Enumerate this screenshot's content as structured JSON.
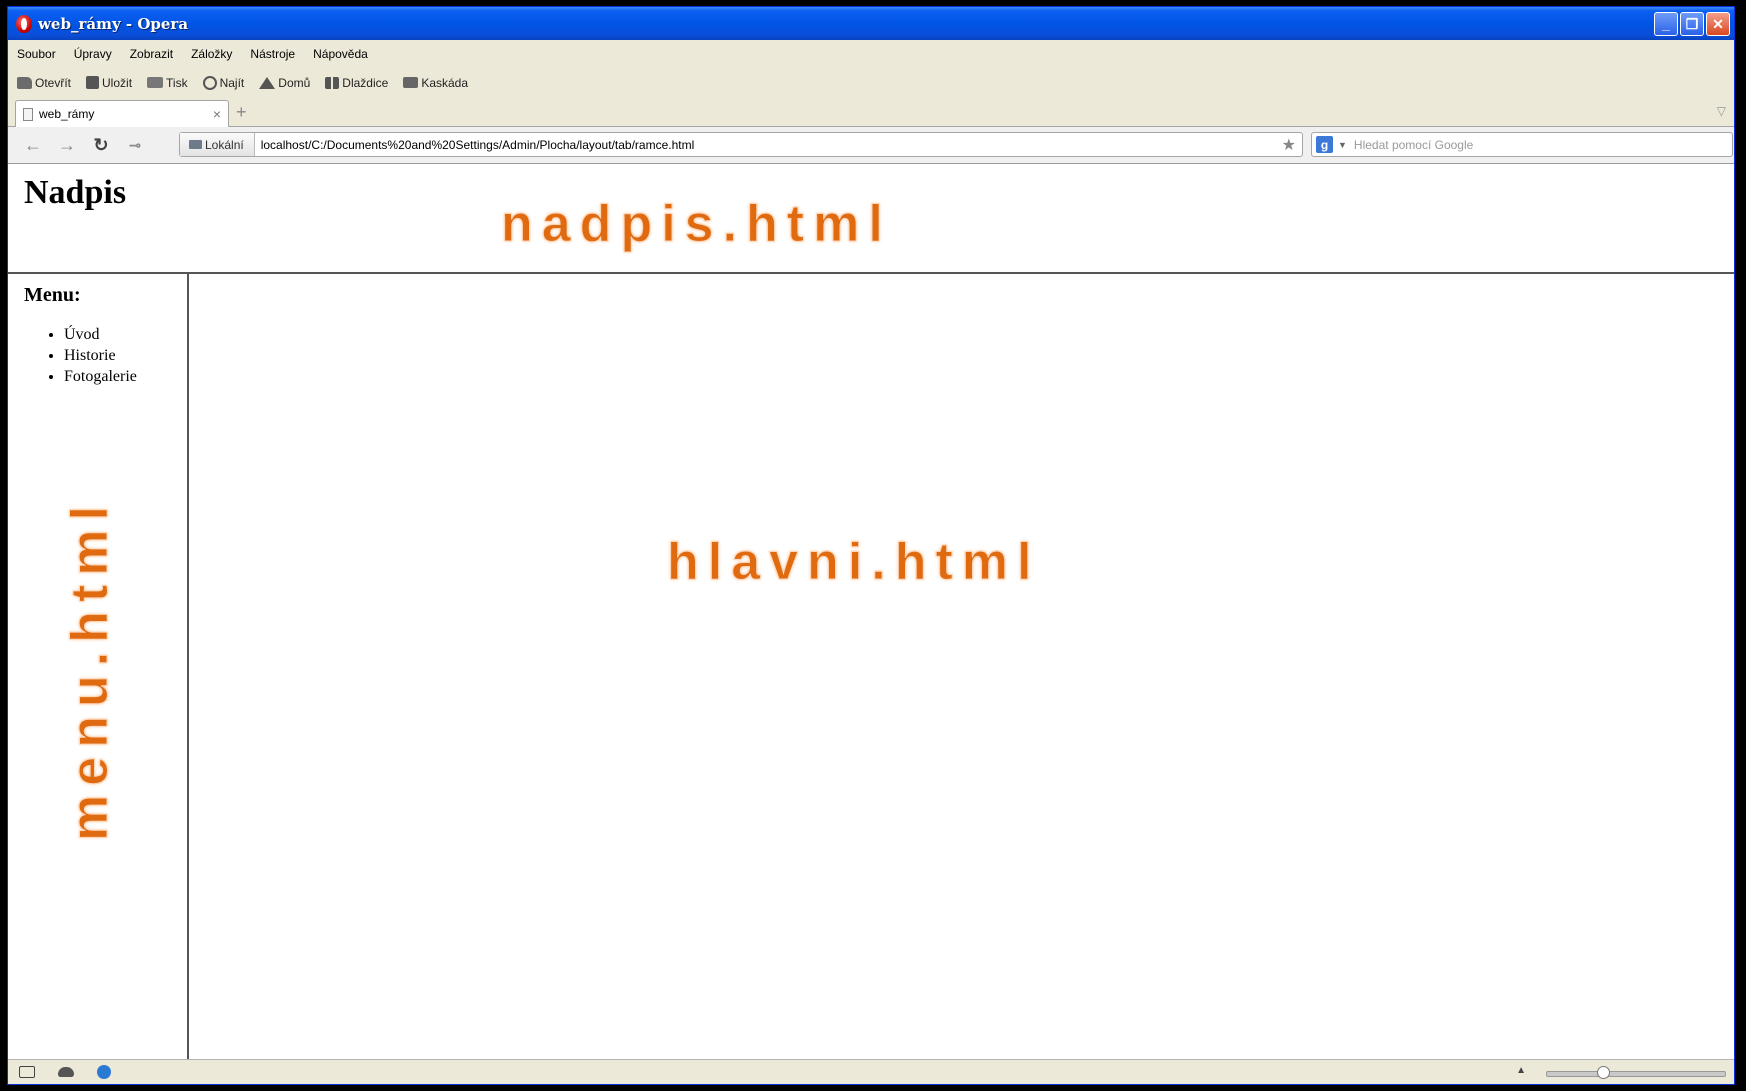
{
  "window": {
    "title": "web_rámy - Opera",
    "controls": {
      "minimize": "_",
      "restore": "❐",
      "close": "✕"
    }
  },
  "menubar": {
    "items": [
      "Soubor",
      "Úpravy",
      "Zobrazit",
      "Záložky",
      "Nástroje",
      "Nápověda"
    ]
  },
  "toolbar": {
    "items": [
      {
        "label": "Otevřít",
        "icon": "folder-icon"
      },
      {
        "label": "Uložit",
        "icon": "save-icon"
      },
      {
        "label": "Tisk",
        "icon": "print-icon"
      },
      {
        "label": "Najít",
        "icon": "magnifier-icon"
      },
      {
        "label": "Domů",
        "icon": "home-icon"
      },
      {
        "label": "Dlaždice",
        "icon": "tile-icon"
      },
      {
        "label": "Kaskáda",
        "icon": "cascade-icon"
      }
    ]
  },
  "tabs": {
    "active": {
      "label": "web_rámy",
      "close": "×"
    },
    "new_tab": "+",
    "menu": "▽"
  },
  "addressbar": {
    "back": "←",
    "forward": "→",
    "reload": "↻",
    "wand": "⊸",
    "badge": "Lokální",
    "url": "localhost/C:/Documents%20and%20Settings/Admin/Plocha/layout/tab/ramce.html",
    "bookmark": "★",
    "search_engine": "g",
    "search_arrow": "▼",
    "search_placeholder": "Hledat pomocí Google"
  },
  "page": {
    "header": {
      "heading": "Nadpis",
      "watermark": "nadpis.html"
    },
    "menu": {
      "heading": "Menu:",
      "items": [
        "Úvod",
        "Historie",
        "Fotogalerie"
      ],
      "watermark": "menu.html"
    },
    "main": {
      "watermark": "hlavni.html"
    }
  },
  "statusbar": {
    "up_arrow": "▲",
    "zoom_level": 0.3
  },
  "colors": {
    "titlebar": "#0054e3",
    "chrome": "#ece9d8",
    "watermark": "#e06a10"
  }
}
